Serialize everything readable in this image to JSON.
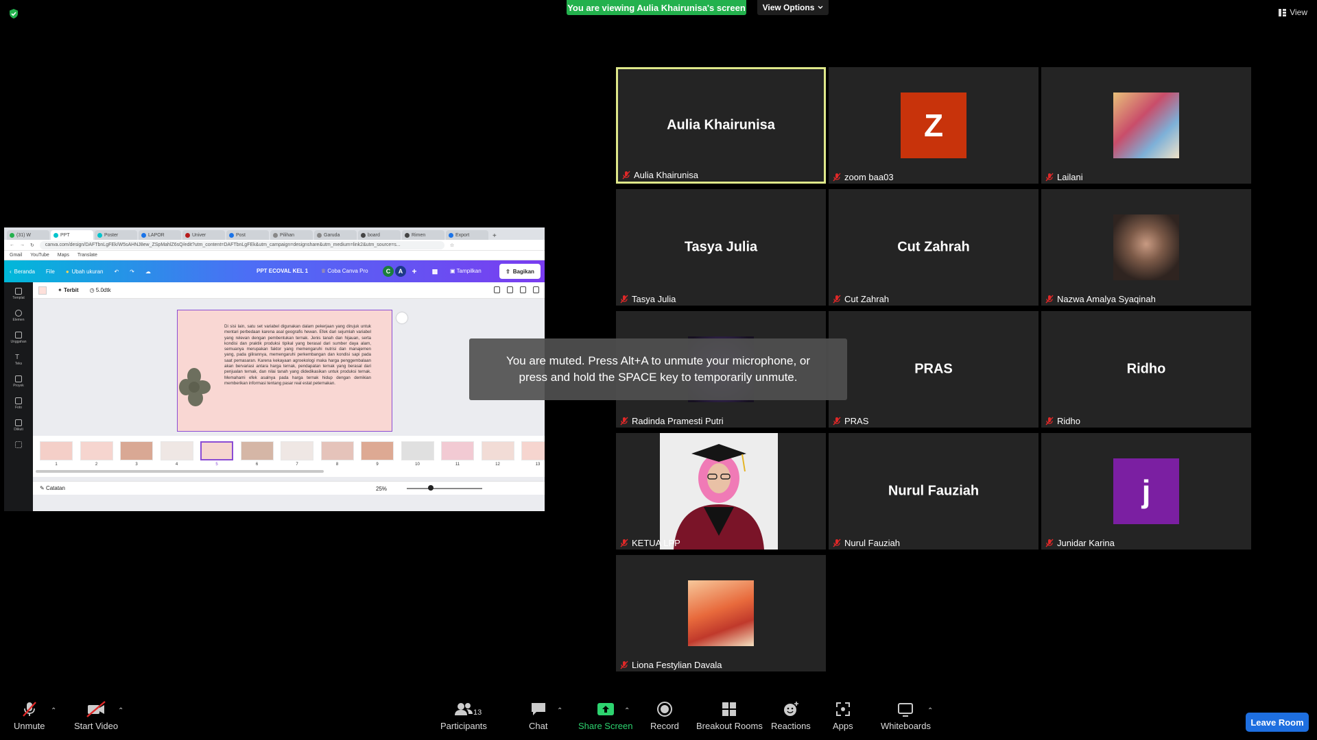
{
  "top": {
    "banner": "You are viewing Aulia Khairunisa's screen",
    "view_options": "View Options",
    "view": "View"
  },
  "toast": {
    "line1": "You are muted. Press Alt+A to unmute your microphone, or",
    "line2": "press and hold the SPACE key to temporarily unmute."
  },
  "participants": [
    {
      "name": "Aulia Khairunisa",
      "display": "Aulia Khairunisa",
      "active": true
    },
    {
      "name": "zoom baa03",
      "avatar_letter": "Z",
      "avatar_color": "#c8330b"
    },
    {
      "name": "Lailani"
    },
    {
      "name": "Tasya Julia",
      "display": "Tasya Julia"
    },
    {
      "name": "Cut Zahrah",
      "display": "Cut Zahrah"
    },
    {
      "name": "Nazwa Amalya Syaqinah"
    },
    {
      "name": "Radinda Pramesti Putri"
    },
    {
      "name": "PRAS",
      "display": "PRAS"
    },
    {
      "name": "Ridho",
      "display": "Ridho"
    },
    {
      "name": "KETUA LPP"
    },
    {
      "name": "Nurul Fauziah",
      "display": "Nurul Fauziah"
    },
    {
      "name": "Junidar Karina",
      "avatar_letter": "j",
      "avatar_color": "#7b1fa2"
    },
    {
      "name": "Liona Festylian Davala"
    }
  ],
  "shared": {
    "tabs": [
      "(31) W",
      "PPT",
      "Poster",
      "LAPOR",
      "Univer",
      "Post",
      "Pilihan",
      "Garuda",
      "board",
      "Rimen",
      "Export"
    ],
    "url": "canva.com/design/DAFTbnLgFEk/W5sAHNJ8ew_ZSpMahlZ6sQ/edit?utm_content=DAFTbnLgFEk&utm_campaign=designshare&utm_medium=link2&utm_source=s...",
    "bookmarks": [
      "Gmail",
      "YouTube",
      "Maps",
      "Translate"
    ],
    "canva": {
      "beranda": "Beranda",
      "file": "File",
      "ubah": "Ubah ukuran",
      "title": "PPT ECOVAL KEL 1",
      "pro": "Coba Canva Pro",
      "tampilkan": "Tampilkan",
      "bagikan": "Bagikan",
      "terbit": "Terbit",
      "duration": "5.0dtk",
      "catatan": "Catatan",
      "zoom": "25%",
      "rail": [
        "Templat",
        "Elemen",
        "Unggahan",
        "Teks",
        "Proyek",
        "Foto",
        "Diikuti",
        ""
      ],
      "slide_text": "Di sisi lain, satu set variabel digunakan dalam pekerjaan yang dirujuk untuk mentari perbedaan karena asal geografis hewan. Efek dari sejumlah variabel yang relevan dengan pembentukan ternak. Jenis tanah dan hijauan, serta kondisi dan praktik produksi tipikal yang berasal dari sumber daya alam, semuanya merupakan faktor yang memengaruhi nutrisi dan manajemen yang, pada gilirannya, memengaruhi perkembangan dan kondisi sapi pada saat pemasaran. Karena kekayaan agroekologi maka harga penggembalaan akan bervariasi antara harga ternak, pendapatan ternak yang berasal dari penjualan ternak, dan nilai tanah yang didedikasikan untuk produksi ternak. Memahami efek asalnya pada harga ternak hidup dengan demikian memberikan informasi tentang pasar real estat peternakan.",
      "thumbs": [
        "1",
        "2",
        "3",
        "4",
        "5",
        "6",
        "7",
        "8",
        "9",
        "10",
        "11",
        "12",
        "13"
      ]
    }
  },
  "toolbar": {
    "unmute": "Unmute",
    "start_video": "Start Video",
    "participants": "Participants",
    "participants_count": "13",
    "chat": "Chat",
    "share": "Share Screen",
    "record": "Record",
    "breakout": "Breakout Rooms",
    "reactions": "Reactions",
    "apps": "Apps",
    "whiteboards": "Whiteboards",
    "leave": "Leave Room"
  }
}
